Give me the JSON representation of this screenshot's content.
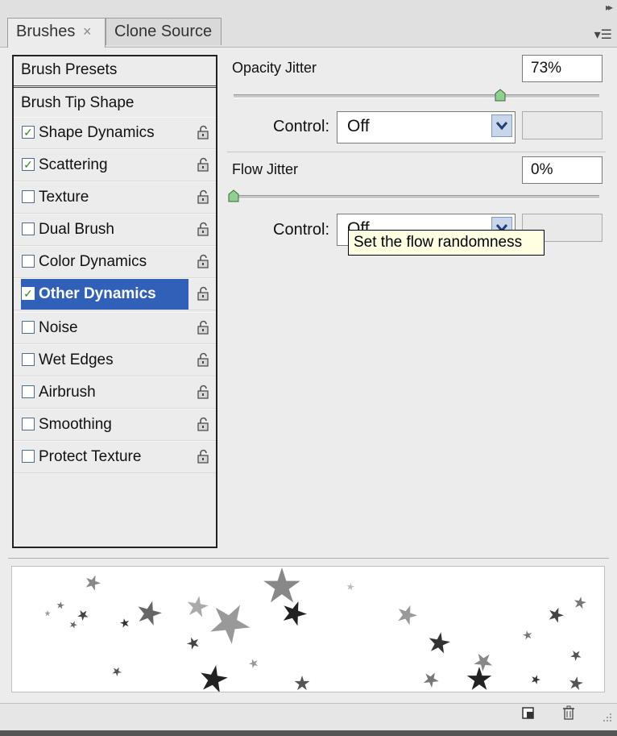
{
  "tabs": {
    "brushes": "Brushes",
    "brushes_close": "×",
    "clone": "Clone Source"
  },
  "left": {
    "presets": "Brush Presets",
    "tip_shape": "Brush Tip Shape",
    "options": [
      {
        "label": "Shape Dynamics",
        "checked": true
      },
      {
        "label": "Scattering",
        "checked": true
      },
      {
        "label": "Texture",
        "checked": false
      },
      {
        "label": "Dual Brush",
        "checked": false
      },
      {
        "label": "Color Dynamics",
        "checked": false
      },
      {
        "label": "Other Dynamics",
        "checked": true,
        "selected": true
      },
      {
        "label": "Noise",
        "checked": false
      },
      {
        "label": "Wet Edges",
        "checked": false
      },
      {
        "label": "Airbrush",
        "checked": false
      },
      {
        "label": "Smoothing",
        "checked": false
      },
      {
        "label": "Protect Texture",
        "checked": false
      }
    ]
  },
  "opacity": {
    "label": "Opacity Jitter",
    "value": "73%",
    "slider_fraction": 0.73,
    "control_label": "Control:",
    "control_value": "Off"
  },
  "flow": {
    "label": "Flow Jitter",
    "value": "0%",
    "slider_fraction": 0,
    "control_label": "Control:",
    "control_value": "Off"
  },
  "tooltip": "Set the flow randomness",
  "colors": {
    "selection": "#3160b8",
    "tooltip_bg": "#ffffe1",
    "checkmark": "#2b8a2b"
  }
}
